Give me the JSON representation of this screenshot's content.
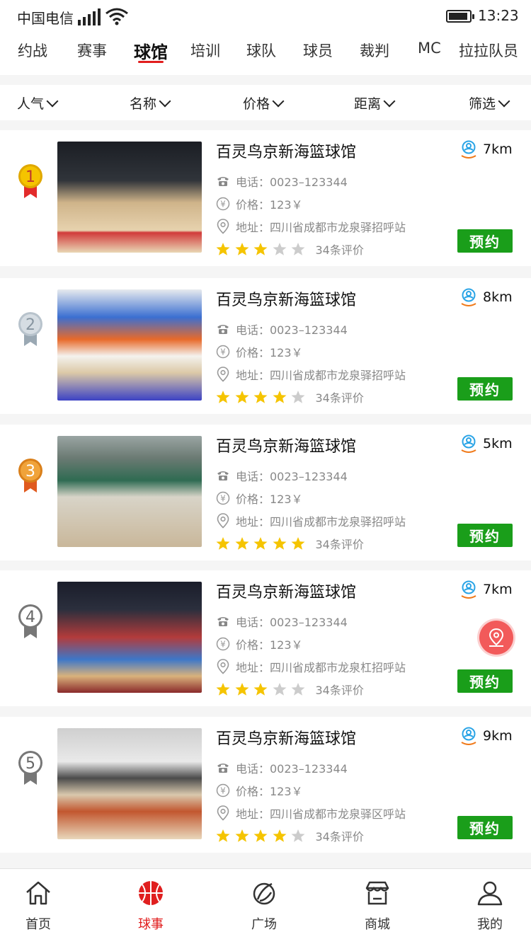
{
  "status_bar": {
    "carrier": "中国电信",
    "time": "13:23"
  },
  "top_nav": {
    "tabs": [
      "约战",
      "赛事",
      "球馆",
      "培训",
      "球队",
      "球员",
      "裁判",
      "MC",
      "拉拉队员"
    ],
    "active_tab": "球馆",
    "accent_color": "#e11d1d"
  },
  "filters": [
    "人气",
    "名称",
    "价格",
    "距离",
    "筛选"
  ],
  "venues": [
    {
      "rank": "1",
      "name": "百灵鸟京新海篮球馆",
      "distance": "7km",
      "phone": "电话：0023–123344",
      "price": "价格：123￥",
      "address": "地址：四川省成都市龙泉驿招呼站",
      "rating": 3,
      "reviews": "34条评价",
      "book_label": "预约",
      "medal": "gold"
    },
    {
      "rank": "2",
      "name": "百灵鸟京新海篮球馆",
      "distance": "8km",
      "phone": "电话：0023–123344",
      "price": "价格：123￥",
      "address": "地址：四川省成都市龙泉驿招呼站",
      "rating": 4,
      "reviews": "34条评价",
      "book_label": "预约",
      "medal": "silver"
    },
    {
      "rank": "3",
      "name": "百灵鸟京新海篮球馆",
      "distance": "5km",
      "phone": "电话：0023–123344",
      "price": "价格：123￥",
      "address": "地址：四川省成都市龙泉驿招呼站",
      "rating": 5,
      "reviews": "34条评价",
      "book_label": "预约",
      "medal": "bronze"
    },
    {
      "rank": "4",
      "name": "百灵鸟京新海篮球馆",
      "distance": "7km",
      "phone": "电话：0023–123344",
      "price": "价格：123￥",
      "address": "地址：四川省成都市龙泉杠招呼站",
      "rating": 3,
      "reviews": "34条评价",
      "book_label": "预约",
      "medal": "gray"
    },
    {
      "rank": "5",
      "name": "百灵鸟京新海篮球馆",
      "distance": "9km",
      "phone": "电话：0023–123344",
      "price": "价格：123￥",
      "address": "地址：四川省成都市龙泉驿区呼站",
      "rating": 4,
      "reviews": "34条评价",
      "book_label": "预约",
      "medal": "gray"
    }
  ],
  "bottom_nav": {
    "items": [
      {
        "label": "首页",
        "icon": "home-icon"
      },
      {
        "label": "球事",
        "icon": "basketball-icon"
      },
      {
        "label": "广场",
        "icon": "plaza-icon"
      },
      {
        "label": "商城",
        "icon": "store-icon"
      },
      {
        "label": "我的",
        "icon": "user-icon"
      }
    ],
    "active": "球事"
  },
  "colors": {
    "book_button": "#1a9e1a",
    "star": "#f5c400",
    "star_empty": "#cccccc",
    "fab": "#f25a5a"
  }
}
